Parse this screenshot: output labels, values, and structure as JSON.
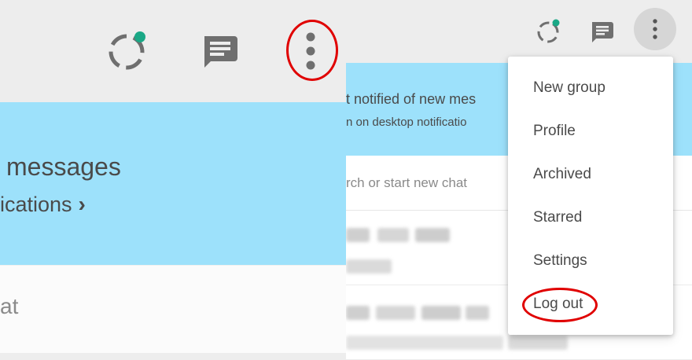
{
  "left_panel": {
    "banner_title": "messages",
    "banner_subtitle": "ications",
    "banner_chevron": "›",
    "search_placeholder": "at",
    "icons": [
      "status-icon",
      "new-chat-icon",
      "menu-icon"
    ]
  },
  "right_panel": {
    "banner_title": "t notified of new mes",
    "banner_subtitle": "n on desktop notificatio",
    "search_placeholder": "rch or start new chat",
    "icons": [
      "status-icon",
      "new-chat-icon",
      "menu-icon"
    ]
  },
  "menu": {
    "items": [
      {
        "label": "New group"
      },
      {
        "label": "Profile"
      },
      {
        "label": "Archived"
      },
      {
        "label": "Starred"
      },
      {
        "label": "Settings"
      },
      {
        "label": "Log out"
      }
    ]
  },
  "colors": {
    "header_bg": "#ededed",
    "banner_bg": "#9de1fb",
    "icon_gray": "#6f6f6f",
    "status_dot": "#1aa886",
    "highlight_red": "#e00000"
  }
}
